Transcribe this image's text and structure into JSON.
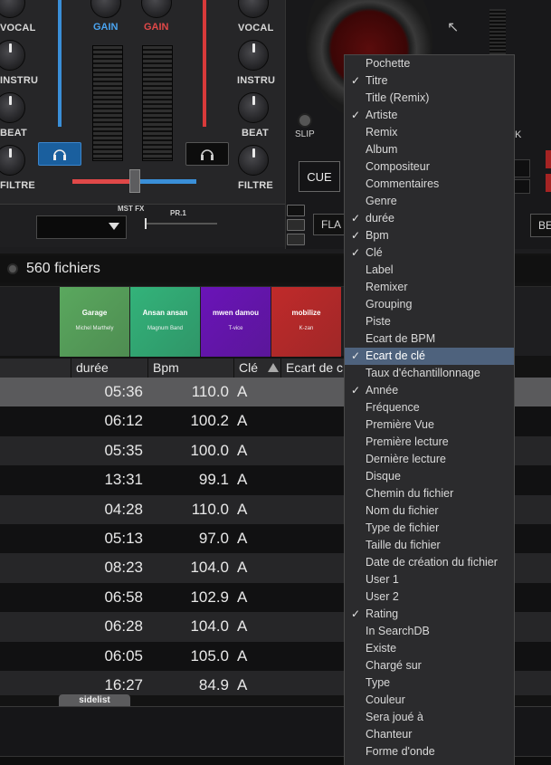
{
  "mixer": {
    "left_labels": [
      "VOCAL",
      "INSTRU",
      "BEAT",
      "FILTRE"
    ],
    "right_labels": [
      "VOCAL",
      "INSTRU",
      "BEAT",
      "FILTRE"
    ],
    "gain_left": "GAIN",
    "gain_right": "GAIN",
    "gain_left_color": "#4aa3ef",
    "gain_right_color": "#e04848",
    "mst_fx_label": "MST FX",
    "pr_label": "PR.1"
  },
  "deck": {
    "slip_label": "SLIP",
    "cue_label": "CUE",
    "fla_label": "FLA",
    "be_label": "BE",
    "partial_k": "K"
  },
  "browser": {
    "file_count": "560 fichiers",
    "covers": [
      {
        "title": "Garage",
        "artist": "Michel Marthely",
        "color": "#5aa85e"
      },
      {
        "title": "Ansan ansan",
        "artist": "Magnum Band",
        "color": "#33b37a"
      },
      {
        "title": "mwen damou",
        "artist": "T-vice",
        "color": "#6a14b8"
      },
      {
        "title": "mobilize",
        "artist": "K-zan",
        "color": "#c02a2a"
      }
    ],
    "columns": {
      "duree": "durée",
      "bpm": "Bpm",
      "cle": "Clé",
      "ecart": "Ecart de c"
    },
    "rows": [
      {
        "duree": "05:36",
        "bpm": "110.0",
        "cle": "A"
      },
      {
        "duree": "06:12",
        "bpm": "100.2",
        "cle": "A"
      },
      {
        "duree": "05:35",
        "bpm": "100.0",
        "cle": "A"
      },
      {
        "duree": "13:31",
        "bpm": "99.1",
        "cle": "A"
      },
      {
        "duree": "04:28",
        "bpm": "110.0",
        "cle": "A"
      },
      {
        "duree": "05:13",
        "bpm": "97.0",
        "cle": "A"
      },
      {
        "duree": "08:23",
        "bpm": "104.0",
        "cle": "A"
      },
      {
        "duree": "06:58",
        "bpm": "102.9",
        "cle": "A"
      },
      {
        "duree": "06:28",
        "bpm": "104.0",
        "cle": "A"
      },
      {
        "duree": "06:05",
        "bpm": "105.0",
        "cle": "A"
      },
      {
        "duree": "16:27",
        "bpm": "84.9",
        "cle": "A"
      }
    ],
    "sidelist_label": "sidelist"
  },
  "context_menu": {
    "items": [
      {
        "label": "Pochette",
        "checked": false,
        "selected": false
      },
      {
        "label": "Titre",
        "checked": true,
        "selected": false
      },
      {
        "label": "Title (Remix)",
        "checked": false,
        "selected": false
      },
      {
        "label": "Artiste",
        "checked": true,
        "selected": false
      },
      {
        "label": "Remix",
        "checked": false,
        "selected": false
      },
      {
        "label": "Album",
        "checked": false,
        "selected": false
      },
      {
        "label": "Compositeur",
        "checked": false,
        "selected": false
      },
      {
        "label": "Commentaires",
        "checked": false,
        "selected": false
      },
      {
        "label": "Genre",
        "checked": false,
        "selected": false
      },
      {
        "label": "durée",
        "checked": true,
        "selected": false
      },
      {
        "label": "Bpm",
        "checked": true,
        "selected": false
      },
      {
        "label": "Clé",
        "checked": true,
        "selected": false
      },
      {
        "label": "Label",
        "checked": false,
        "selected": false
      },
      {
        "label": "Remixer",
        "checked": false,
        "selected": false
      },
      {
        "label": "Grouping",
        "checked": false,
        "selected": false
      },
      {
        "label": "Piste",
        "checked": false,
        "selected": false
      },
      {
        "label": "Ecart de BPM",
        "checked": false,
        "selected": false
      },
      {
        "label": "Ecart de clé",
        "checked": true,
        "selected": true
      },
      {
        "label": "Taux d'échantillonnage",
        "checked": false,
        "selected": false
      },
      {
        "label": "Année",
        "checked": true,
        "selected": false
      },
      {
        "label": "Fréquence",
        "checked": false,
        "selected": false
      },
      {
        "label": "Première Vue",
        "checked": false,
        "selected": false
      },
      {
        "label": "Première lecture",
        "checked": false,
        "selected": false
      },
      {
        "label": "Dernière lecture",
        "checked": false,
        "selected": false
      },
      {
        "label": "Disque",
        "checked": false,
        "selected": false
      },
      {
        "label": "Chemin du fichier",
        "checked": false,
        "selected": false
      },
      {
        "label": "Nom du fichier",
        "checked": false,
        "selected": false
      },
      {
        "label": "Type de fichier",
        "checked": false,
        "selected": false
      },
      {
        "label": "Taille du fichier",
        "checked": false,
        "selected": false
      },
      {
        "label": "Date de création du fichier",
        "checked": false,
        "selected": false
      },
      {
        "label": "User 1",
        "checked": false,
        "selected": false
      },
      {
        "label": "User 2",
        "checked": false,
        "selected": false
      },
      {
        "label": "Rating",
        "checked": true,
        "selected": false
      },
      {
        "label": "In SearchDB",
        "checked": false,
        "selected": false
      },
      {
        "label": "Existe",
        "checked": false,
        "selected": false
      },
      {
        "label": "Chargé sur",
        "checked": false,
        "selected": false
      },
      {
        "label": "Type",
        "checked": false,
        "selected": false
      },
      {
        "label": "Couleur",
        "checked": false,
        "selected": false
      },
      {
        "label": "Sera joué à",
        "checked": false,
        "selected": false
      },
      {
        "label": "Chanteur",
        "checked": false,
        "selected": false
      },
      {
        "label": "Forme d'onde",
        "checked": false,
        "selected": false
      }
    ],
    "check_glyph": "✓",
    "selected_color": "#4e627d"
  }
}
